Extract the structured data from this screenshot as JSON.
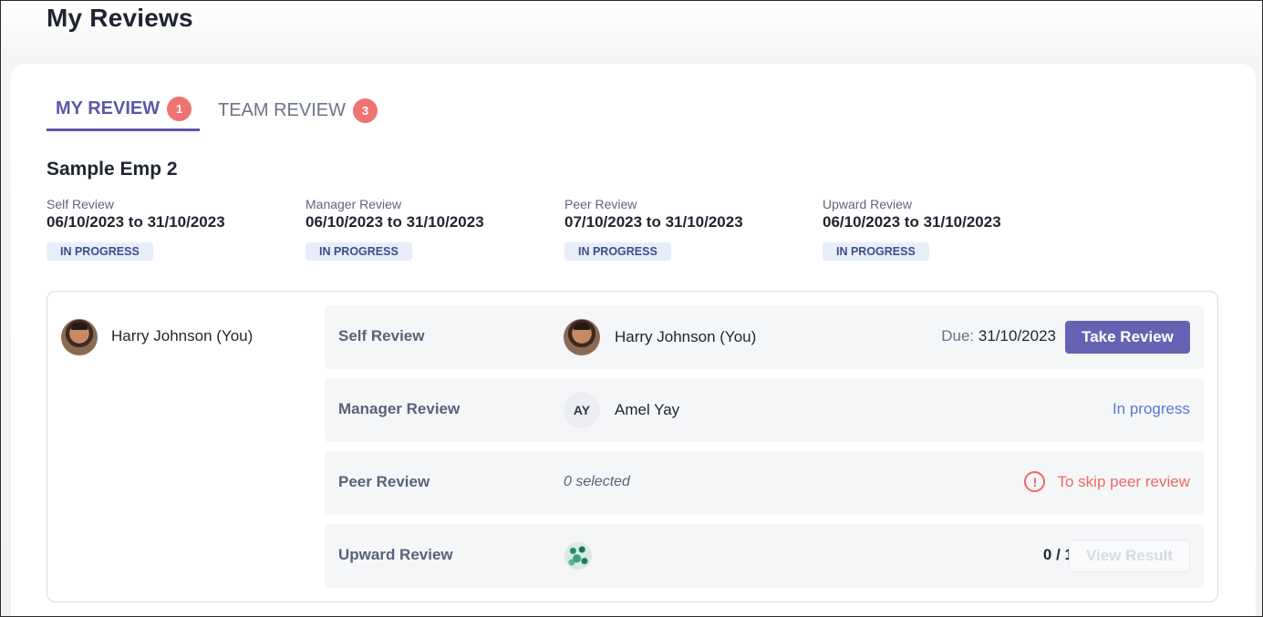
{
  "page": {
    "title": "My Reviews"
  },
  "tabs": [
    {
      "label": "MY REVIEW",
      "badge": "1"
    },
    {
      "label": "TEAM REVIEW",
      "badge": "3"
    }
  ],
  "employee": {
    "name": "Sample Emp 2"
  },
  "periods": [
    {
      "label": "Self Review",
      "dates": "06/10/2023 to 31/10/2023",
      "status": "IN PROGRESS"
    },
    {
      "label": "Manager Review",
      "dates": "06/10/2023 to 31/10/2023",
      "status": "IN PROGRESS"
    },
    {
      "label": "Peer Review",
      "dates": "07/10/2023 to 31/10/2023",
      "status": "IN PROGRESS"
    },
    {
      "label": "Upward Review",
      "dates": "06/10/2023 to 31/10/2023",
      "status": "IN PROGRESS"
    }
  ],
  "reviewee": {
    "name": "Harry Johnson (You)",
    "avatar_icon": "user-photo"
  },
  "rows": {
    "self": {
      "label": "Self Review",
      "reviewer": "Harry Johnson (You)",
      "due_label": "Due:",
      "due_date": "31/10/2023",
      "action": "Take Review"
    },
    "manager": {
      "label": "Manager Review",
      "initials": "AY",
      "reviewer": "Amel Yay",
      "status": "In progress"
    },
    "peer": {
      "label": "Peer Review",
      "selected": "0 selected",
      "action": "To skip peer review",
      "icon": "alert-circle-icon"
    },
    "upward": {
      "label": "Upward Review",
      "count": "0 / 1",
      "action": "View Result"
    }
  },
  "colors": {
    "accent": "#6662b3",
    "badge": "#ef7471",
    "link": "#5a77d4",
    "warning": "#ea6a66"
  }
}
